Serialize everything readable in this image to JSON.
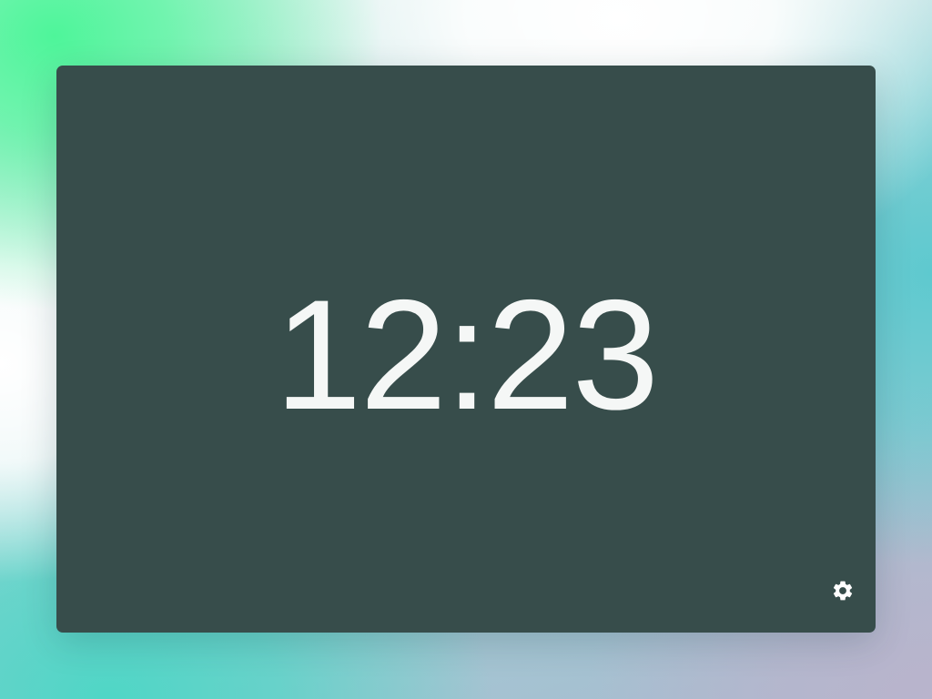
{
  "clock": {
    "time": "12:23"
  },
  "controls": {
    "settings_icon": "gear-icon"
  },
  "colors": {
    "window_background": "#374d4b",
    "time_text": "#f5f7f6",
    "icon": "#ffffff"
  }
}
